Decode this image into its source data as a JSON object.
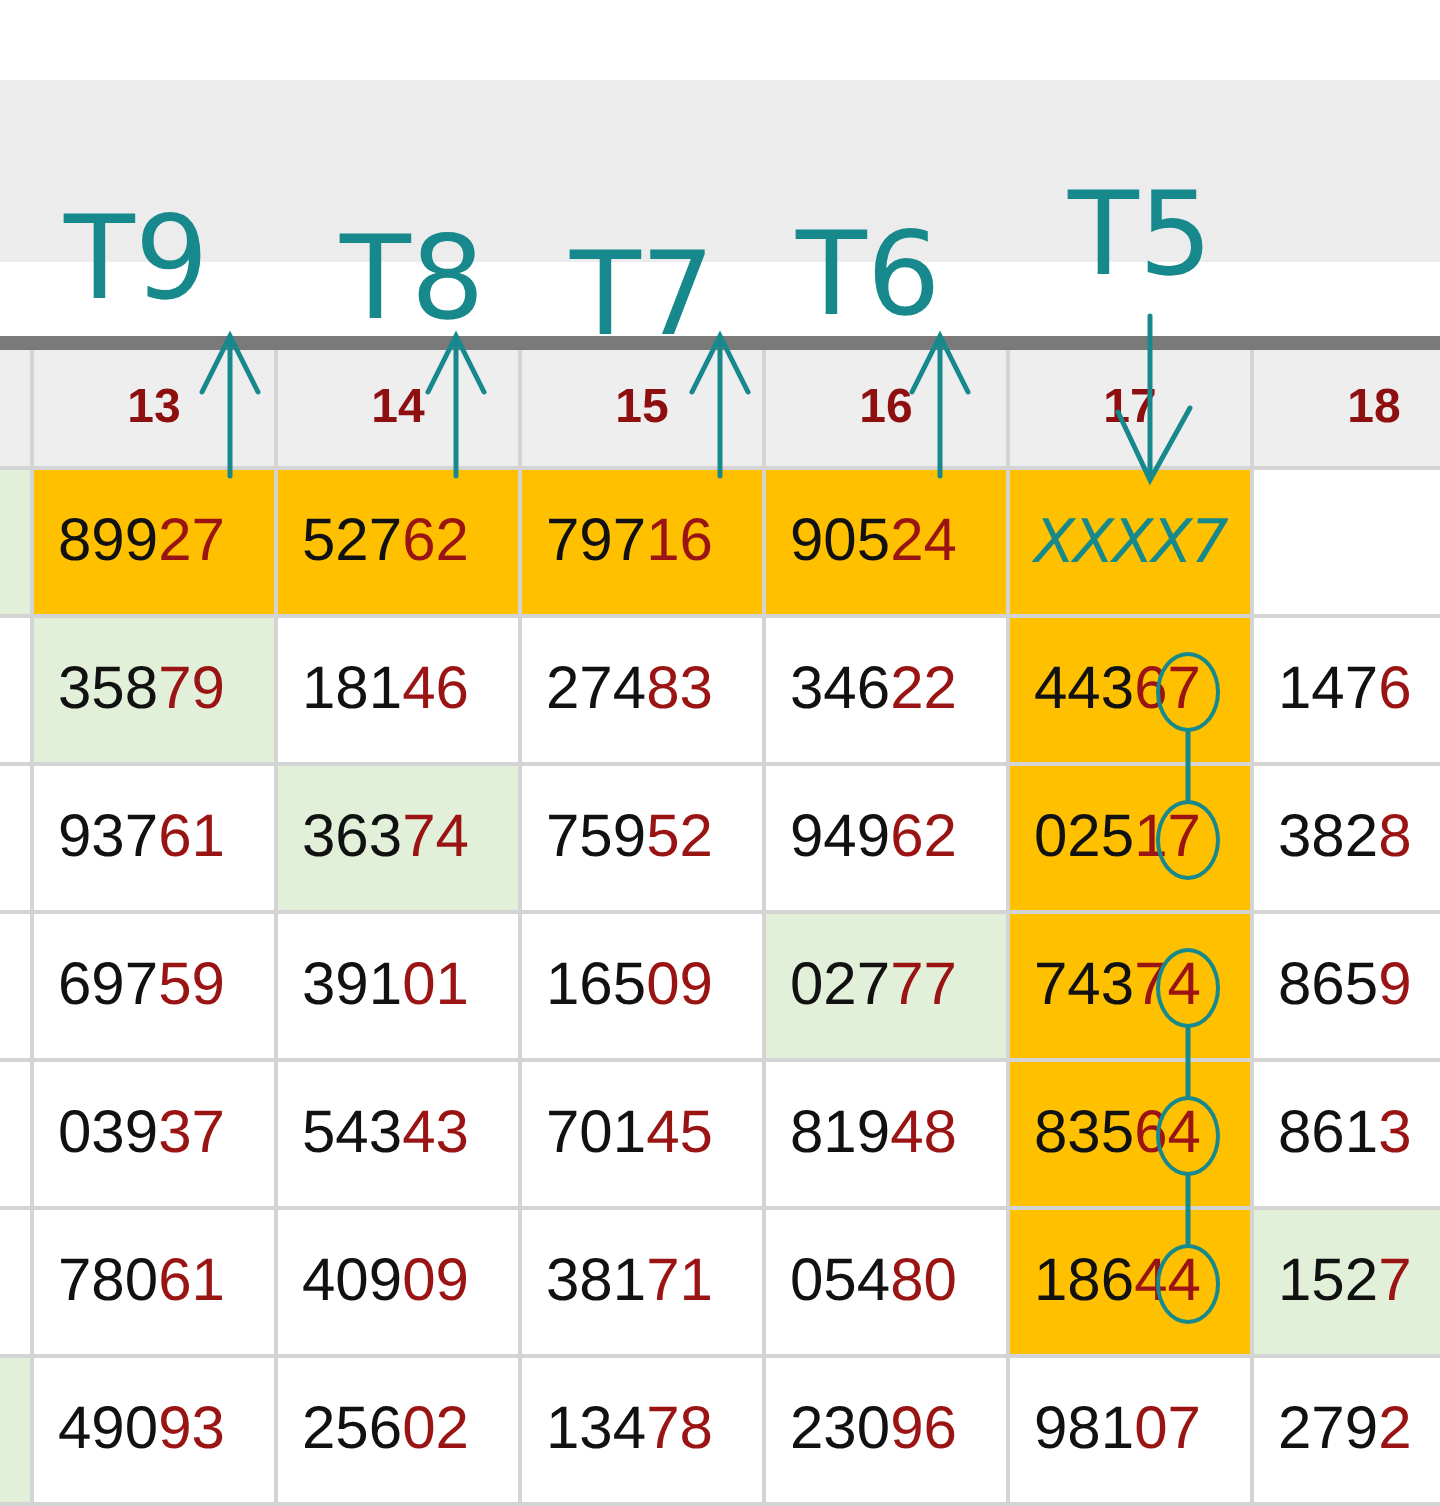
{
  "columns": [
    "13",
    "14",
    "15",
    "16",
    "17",
    "18"
  ],
  "rows": [
    {
      "cells": [
        {
          "color": "#e2f0d9"
        },
        {
          "value": "89927",
          "color": "#ffc000",
          "circled": false
        },
        {
          "value": "52762",
          "color": "#ffc000",
          "circled": false
        },
        {
          "value": "79716",
          "color": "#ffc000",
          "circled": false
        },
        {
          "value": "90524",
          "color": "#ffc000",
          "circled": false
        },
        {
          "note": "XXXX7",
          "color": "#ffc000",
          "circled": false
        },
        {}
      ]
    },
    {
      "cells": [
        {},
        {
          "value": "35879",
          "color": "#e2f0d9",
          "circled": false
        },
        {
          "value": "18146",
          "circled": false
        },
        {
          "value": "27483",
          "circled": false
        },
        {
          "value": "34622",
          "circled": false
        },
        {
          "value": "44367",
          "color": "#ffc000",
          "circled": true
        },
        {
          "value": "1476",
          "circled": false
        }
      ]
    },
    {
      "cells": [
        {},
        {
          "value": "93761",
          "circled": false
        },
        {
          "value": "36374",
          "color": "#e2f0d9",
          "circled": false
        },
        {
          "value": "75952",
          "circled": false
        },
        {
          "value": "94962",
          "circled": false
        },
        {
          "value": "02517",
          "color": "#ffc000",
          "circled": true
        },
        {
          "value": "3828",
          "circled": false
        }
      ]
    },
    {
      "cells": [
        {},
        {
          "value": "69759",
          "circled": false
        },
        {
          "value": "39101",
          "circled": false
        },
        {
          "value": "16509",
          "circled": false
        },
        {
          "value": "02777",
          "color": "#e2f0d9",
          "circled": false
        },
        {
          "value": "74374",
          "color": "#ffc000",
          "circled": true
        },
        {
          "value": "8659",
          "circled": false
        }
      ]
    },
    {
      "cells": [
        {},
        {
          "value": "03937",
          "circled": false
        },
        {
          "value": "54343",
          "circled": false
        },
        {
          "value": "70145",
          "circled": false
        },
        {
          "value": "81948",
          "circled": false
        },
        {
          "value": "83564",
          "color": "#ffc000",
          "circled": true
        },
        {
          "value": "8613",
          "circled": false
        }
      ]
    },
    {
      "cells": [
        {},
        {
          "value": "78061",
          "circled": false
        },
        {
          "value": "40909",
          "circled": false
        },
        {
          "value": "38171",
          "circled": false
        },
        {
          "value": "05480",
          "circled": false
        },
        {
          "value": "18644",
          "color": "#ffc000",
          "circled": true
        },
        {
          "value": "1527",
          "color": "#e2f0d9",
          "circled": false
        }
      ]
    },
    {
      "cells": [
        {
          "color": "#e2f0d9"
        },
        {
          "value": "49093",
          "circled": false
        },
        {
          "value": "25602",
          "circled": false
        },
        {
          "value": "13478",
          "circled": false
        },
        {
          "value": "23096",
          "circled": false
        },
        {
          "value": "98107",
          "circled": false
        },
        {
          "value": "2792",
          "circled": false
        }
      ]
    }
  ],
  "annotations": [
    {
      "text": "T9",
      "kind": "up"
    },
    {
      "text": "T8",
      "kind": "up"
    },
    {
      "text": "T7",
      "kind": "up"
    },
    {
      "text": "T6",
      "kind": "up"
    },
    {
      "text": "T5",
      "kind": "down"
    }
  ]
}
